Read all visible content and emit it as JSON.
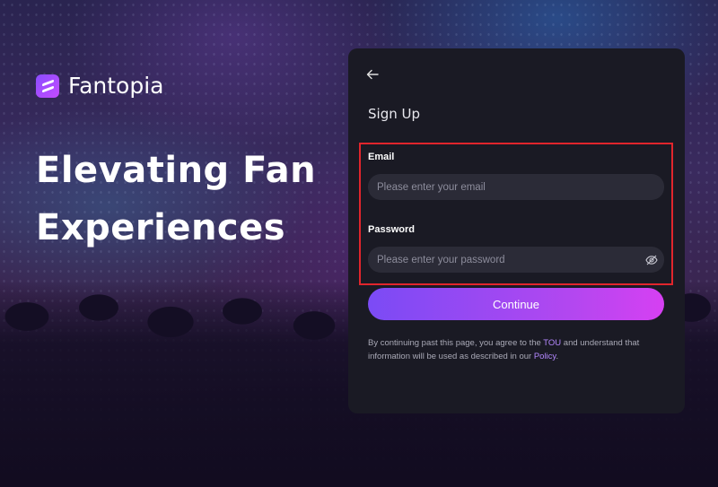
{
  "brand": {
    "name": "Fantopia"
  },
  "hero": {
    "headline_line1": "Elevating Fan",
    "headline_line2": "Experiences"
  },
  "form": {
    "title": "Sign Up",
    "email_label": "Email",
    "email_placeholder": "Please enter your email",
    "password_label": "Password",
    "password_placeholder": "Please enter your password",
    "continue_label": "Continue",
    "terms_pre": "By continuing past this page, you agree to the ",
    "terms_tou": "TOU",
    "terms_mid": " and understand that information will be used as described in our ",
    "terms_policy": "Policy",
    "terms_end": "."
  },
  "icons": {
    "back": "arrow-left-icon",
    "password_toggle": "eye-off-icon",
    "logo": "fantopia-logo-icon"
  },
  "colors": {
    "accent_start": "#7b4bf5",
    "accent_end": "#d640f2",
    "card_bg": "#1a1a24",
    "highlight_border": "#e1252c",
    "link": "#b488ff"
  }
}
